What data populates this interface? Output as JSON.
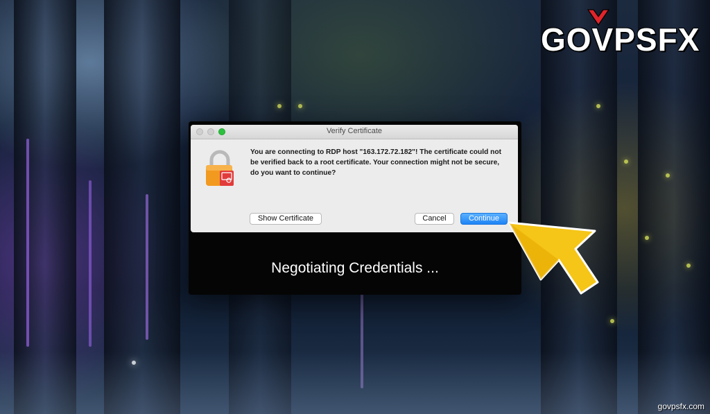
{
  "brand": {
    "logo_text": "GOVPSFX",
    "watermark": "govpsfx.com"
  },
  "dialog": {
    "title": "Verify Certificate",
    "message": "You are connecting to RDP host \"163.172.72.182\"! The certificate could not be verified back to a root certificate. Your connection might not be secure, do you want to continue?",
    "icon": "lock-certificate-icon",
    "buttons": {
      "show_certificate": "Show Certificate",
      "cancel": "Cancel",
      "continue": "Continue"
    },
    "traffic_lights": {
      "close": "#d0d0d0",
      "minimize": "#d0d0d0",
      "zoom": "#2cc13f"
    }
  },
  "rdp_window": {
    "status": "Negotiating Credentials ..."
  },
  "colors": {
    "accent_blue": "#1e84f5",
    "cursor_yellow": "#f5c518",
    "lock_orange": "#f29a1f"
  }
}
